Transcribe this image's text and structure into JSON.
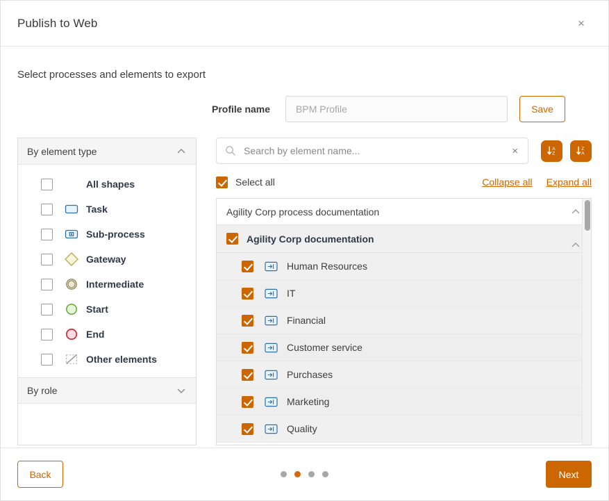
{
  "dialog": {
    "title": "Publish to Web",
    "close_label": "×",
    "section_title": "Select processes and elements to export"
  },
  "profile": {
    "label": "Profile name",
    "value": "",
    "placeholder": "BPM Profile",
    "save_label": "Save"
  },
  "left_panel": {
    "accordion_element_type": "By element type",
    "accordion_role": "By role",
    "items": [
      {
        "label": "All shapes",
        "icon": "none",
        "checked": false
      },
      {
        "label": "Task",
        "icon": "task",
        "checked": false
      },
      {
        "label": "Sub-process",
        "icon": "sub-process",
        "checked": false
      },
      {
        "label": "Gateway",
        "icon": "gateway",
        "checked": false
      },
      {
        "label": "Intermediate",
        "icon": "intermediate",
        "checked": false
      },
      {
        "label": "Start",
        "icon": "start",
        "checked": false
      },
      {
        "label": "End",
        "icon": "end",
        "checked": false
      },
      {
        "label": "Other elements",
        "icon": "other",
        "checked": false
      }
    ]
  },
  "search": {
    "value": "",
    "placeholder": "Search by element name...",
    "clear_label": "×"
  },
  "toolbar": {
    "select_all_label": "Select all",
    "select_all_checked": true,
    "collapse_all_label": "Collapse all",
    "expand_all_label": "Expand all",
    "sort_asc_name": "sort-a-z-button",
    "sort_desc_name": "sort-z-a-button"
  },
  "tree": {
    "root_label": "Agility Corp process documentation",
    "group_label": "Agility Corp documentation",
    "group_checked": true,
    "nodes": [
      {
        "label": "Human Resources",
        "checked": true
      },
      {
        "label": "IT",
        "checked": true
      },
      {
        "label": "Financial",
        "checked": true
      },
      {
        "label": "Customer service",
        "checked": true
      },
      {
        "label": "Purchases",
        "checked": true
      },
      {
        "label": "Marketing",
        "checked": true
      },
      {
        "label": "Quality",
        "checked": true
      }
    ]
  },
  "footer": {
    "back_label": "Back",
    "next_label": "Next",
    "steps": 4,
    "active_step": 2
  },
  "colors": {
    "accent": "#cc6600",
    "accent_dot": "#d2690a",
    "task_fill": "#e8f4fb",
    "task_stroke": "#2f6fa8",
    "gateway_fill": "#f7f4d8",
    "gateway_stroke": "#b3ab4e",
    "intermediate_fill": "#ebe7d0",
    "intermediate_stroke": "#8d8455",
    "start_fill": "#e6f7d9",
    "start_stroke": "#5ba32b",
    "end_fill": "#fadde0",
    "end_stroke": "#cc3344"
  }
}
